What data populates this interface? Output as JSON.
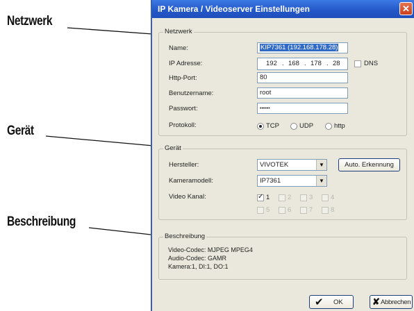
{
  "callouts": {
    "netzwerk": "Netzwerk",
    "geraet": "Gerät",
    "beschreibung": "Beschreibung"
  },
  "window": {
    "title": "IP Kamera / Videoserver Einstellungen",
    "close_glyph": "✕"
  },
  "netzwerk": {
    "legend": "Netzwerk",
    "name_label": "Name:",
    "name_value": "KIP7361 (192.168.178.28)",
    "ip_label": "IP Adresse:",
    "ip_parts": [
      "192",
      "168",
      "178",
      "28"
    ],
    "dns_label": "DNS",
    "dns_checked": false,
    "port_label": "Http-Port:",
    "port_value": "80",
    "user_label": "Benutzername:",
    "user_value": "root",
    "pass_label": "Passwort:",
    "pass_value": "••••••",
    "proto_label": "Protokoll:",
    "protocols": [
      "TCP",
      "UDP",
      "http"
    ],
    "protocol_selected": "TCP"
  },
  "geraet": {
    "legend": "Gerät",
    "manufacturer_label": "Hersteller:",
    "manufacturer_value": "VIVOTEK",
    "auto_detect_label": "Auto. Erkennung",
    "model_label": "Kameramodell:",
    "model_value": "IP7361",
    "channel_label": "Video Kanal:",
    "channels": [
      "1",
      "2",
      "3",
      "4",
      "5",
      "6",
      "7",
      "8"
    ],
    "channel_selected": "1"
  },
  "beschreibung": {
    "legend": "Beschreibung",
    "lines": [
      "Video-Codec: MJPEG MPEG4",
      "Audio-Codec: GAMR",
      "Kamera:1, DI:1, DO:1"
    ]
  },
  "footer": {
    "ok_label": "OK",
    "cancel_label": "Abbrechen"
  }
}
